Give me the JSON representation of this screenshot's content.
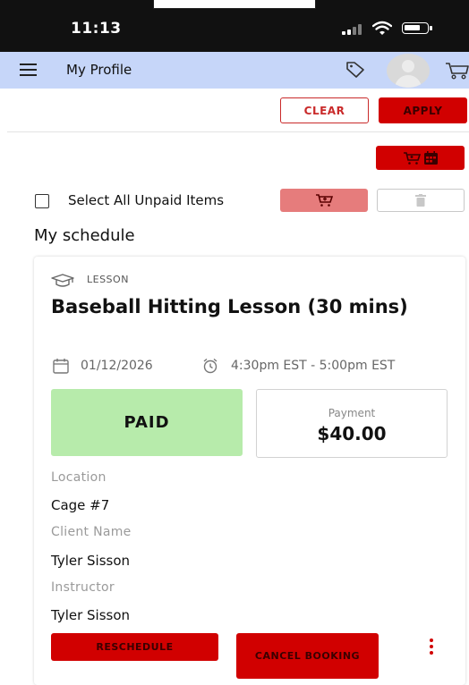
{
  "status_bar": {
    "time": "11:13",
    "signal_icon": "signal-bars-icon",
    "wifi_icon": "wifi-icon",
    "battery_icon": "battery-icon"
  },
  "header": {
    "title": "My Profile",
    "menu_icon": "hamburger-menu-icon",
    "tag_icon": "tag-icon",
    "avatar_icon": "user-avatar-icon",
    "cart_icon": "cart-icon",
    "background": "#c6d6f9"
  },
  "filters": {
    "clear_label": "CLEAR",
    "apply_label": "APPLY"
  },
  "toolbar": {
    "cart_calendar_icons": [
      "cart-icon",
      "calendar-icon"
    ]
  },
  "selection": {
    "select_all_label": "Select All Unpaid Items",
    "checked": false,
    "pay_icon": "cart-add-icon",
    "delete_icon": "trash-icon"
  },
  "schedule": {
    "title": "My schedule",
    "bookings": [
      {
        "category": "LESSON",
        "category_icon": "graduation-cap-icon",
        "title": "Baseball Hitting Lesson (30 mins)",
        "date": "01/12/2026",
        "time": "4:30pm EST - 5:00pm EST",
        "status": "PAID",
        "payment_label": "Payment",
        "payment_amount": "$40.00",
        "location_label": "Location",
        "location": "Cage #7",
        "client_label": "Client Name",
        "client": "Tyler Sisson",
        "instructor_label": "Instructor",
        "instructor": "Tyler Sisson",
        "reschedule_label": "RESCHEDULE",
        "cancel_label": "CANCEL BOOKING",
        "more_icon": "more-vertical-icon"
      }
    ]
  },
  "colors": {
    "accent_red": "#d10000",
    "paid_green": "#b7ebab",
    "disabled_red": "#e67c7c"
  }
}
